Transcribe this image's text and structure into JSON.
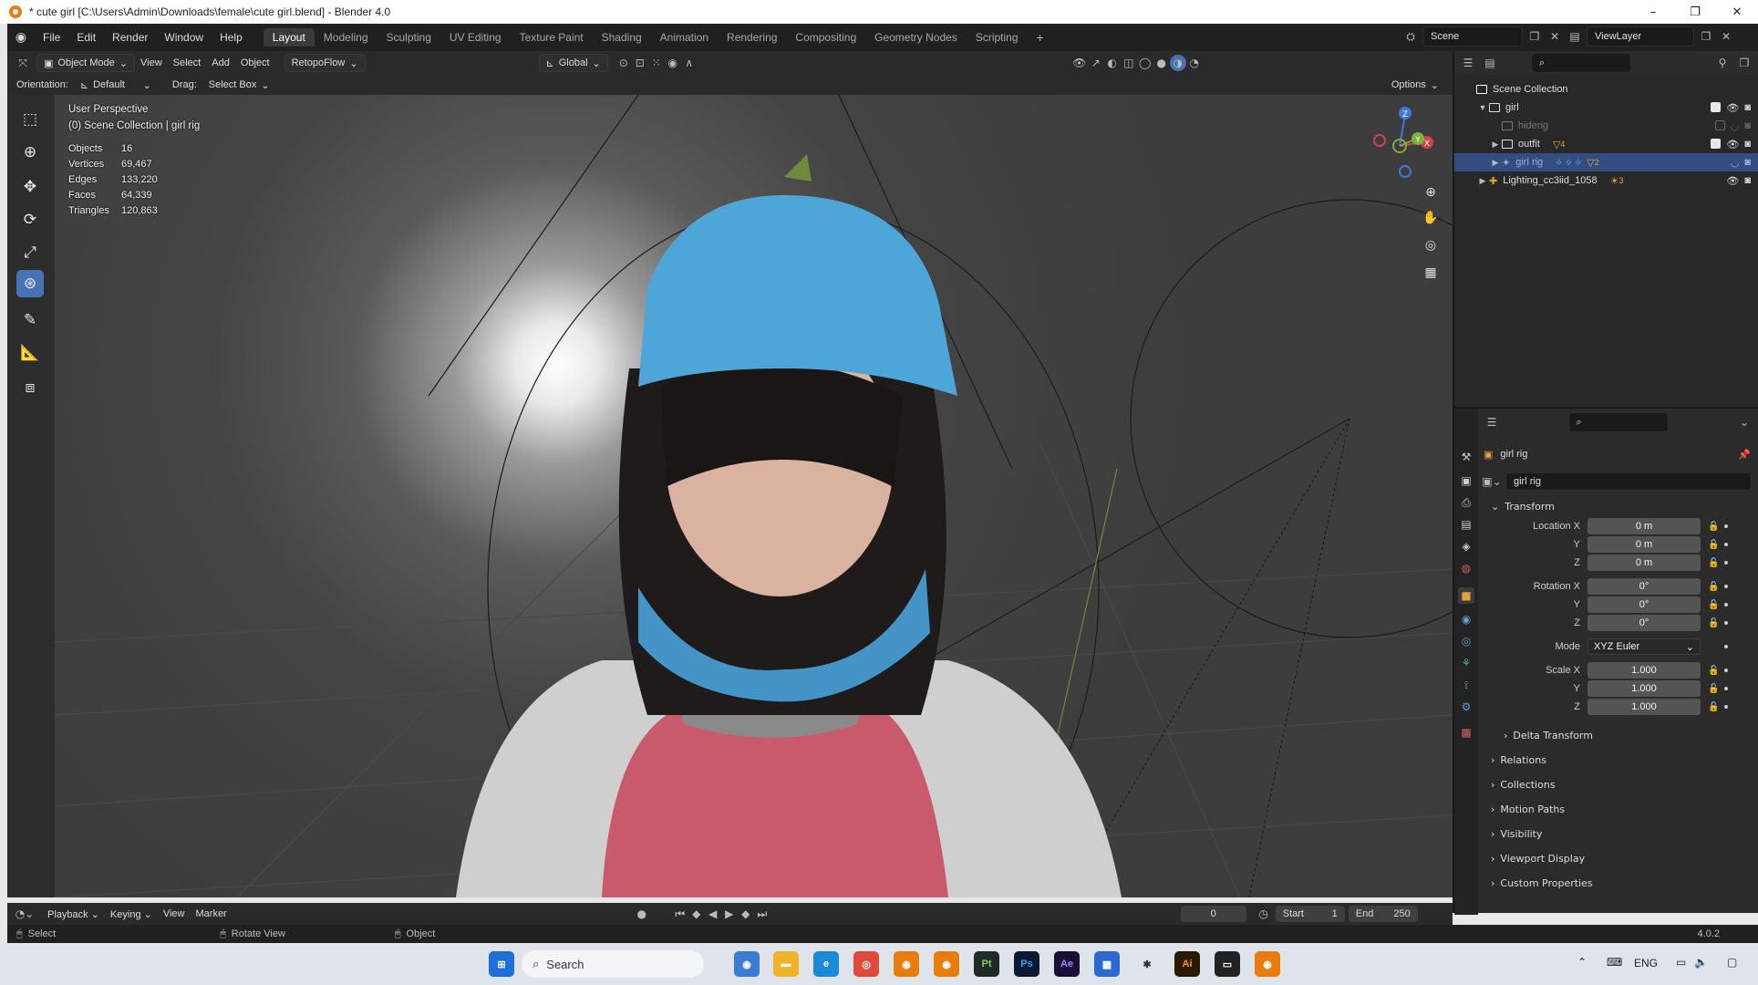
{
  "window": {
    "title": "* cute girl [C:\\Users\\Admin\\Downloads\\female\\cute girl.blend] - Blender 4.0",
    "controls": [
      "–",
      "❐",
      "✕"
    ]
  },
  "menu": [
    "File",
    "Edit",
    "Render",
    "Window",
    "Help"
  ],
  "workspaces": [
    "Layout",
    "Modeling",
    "Sculpting",
    "UV Editing",
    "Texture Paint",
    "Shading",
    "Animation",
    "Rendering",
    "Compositing",
    "Geometry Nodes",
    "Scripting"
  ],
  "active_workspace": "Layout",
  "scene": {
    "name": "Scene",
    "view_layer": "ViewLayer"
  },
  "viewport_header": {
    "mode": "Object Mode",
    "menus": [
      "View",
      "Select",
      "Add",
      "Object"
    ],
    "addon": "RetopoFlow",
    "transform_orientation": "Global",
    "orientation_label": "Orientation:",
    "orientation_value": "Default",
    "drag_label": "Drag:",
    "drag_value": "Select Box",
    "options": "Options"
  },
  "viewport": {
    "view_name": "User Perspective",
    "context": "(0) Scene Collection | girl rig",
    "stats": [
      {
        "label": "Objects",
        "value": "16"
      },
      {
        "label": "Vertices",
        "value": "69,467"
      },
      {
        "label": "Edges",
        "value": "133,220"
      },
      {
        "label": "Faces",
        "value": "64,339"
      },
      {
        "label": "Triangles",
        "value": "120,863"
      }
    ],
    "gizmo_axes": {
      "x": "X",
      "y": "Y",
      "z": "Z"
    }
  },
  "outliner": {
    "root": "Scene Collection",
    "rows": [
      {
        "name": "girl",
        "type": "collection",
        "expanded": true
      },
      {
        "name": "hiderig",
        "type": "collection",
        "dim": true
      },
      {
        "name": "outfit",
        "type": "collection",
        "badge": "4"
      },
      {
        "name": "girl rig",
        "type": "armature",
        "selected": true,
        "badge": "2"
      },
      {
        "name": "Lighting_cc3iid_1058",
        "type": "object",
        "badge": "3"
      }
    ]
  },
  "properties": {
    "object_name": "girl rig",
    "data_name": "girl rig",
    "transform": {
      "title": "Transform",
      "location": {
        "label": "Location X",
        "x": "0 m",
        "y": "0 m",
        "z": "0 m"
      },
      "rotation": {
        "label": "Rotation X",
        "x": "0°",
        "y": "0°",
        "z": "0°"
      },
      "mode_label": "Mode",
      "mode": "XYZ Euler",
      "scale": {
        "label": "Scale X",
        "x": "1.000",
        "y": "1.000",
        "z": "1.000"
      },
      "y_label": "Y",
      "z_label": "Z",
      "delta": "Delta Transform"
    },
    "sections": [
      "Relations",
      "Collections",
      "Motion Paths",
      "Visibility",
      "Viewport Display",
      "Custom Properties"
    ]
  },
  "timeline": {
    "menus": [
      "Playback",
      "Keying",
      "View",
      "Marker"
    ],
    "current_frame": "0",
    "start_label": "Start",
    "start": "1",
    "end_label": "End",
    "end": "250"
  },
  "status_bar": {
    "items": [
      "Select",
      "Rotate View",
      "Object"
    ],
    "version": "4.0.2"
  },
  "taskbar": {
    "search_placeholder": "Search",
    "language": "ENG",
    "apps": [
      "Pt",
      "Ps",
      "Ae",
      "Ai"
    ]
  }
}
